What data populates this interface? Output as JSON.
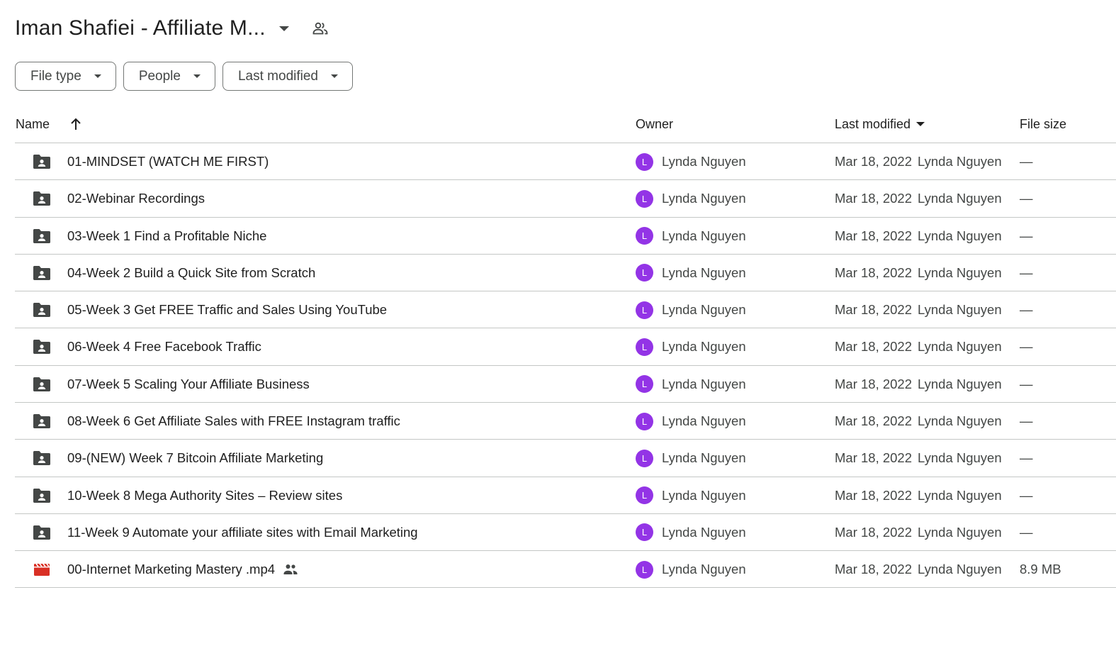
{
  "header": {
    "title": "Iman Shafiei - Affiliate M...",
    "caret_icon": "arrow-drop-down-icon",
    "shared_icon": "people-outline-icon"
  },
  "filters": [
    {
      "label": "File type"
    },
    {
      "label": "People"
    },
    {
      "label": "Last modified"
    }
  ],
  "columns": {
    "name": "Name",
    "owner": "Owner",
    "last_modified": "Last modified",
    "file_size": "File size"
  },
  "colors": {
    "avatar": "#9334e6",
    "folder_icon": "#444746",
    "video_icon": "#d93025",
    "divider": "#c4c7c5"
  },
  "rows": [
    {
      "type": "folder",
      "name": "01-MINDSET (WATCH ME FIRST)",
      "owner_initial": "L",
      "owner": "Lynda Nguyen",
      "modified_date": "Mar 18, 2022",
      "modified_by": "Lynda Nguyen",
      "size": "—",
      "shared": false
    },
    {
      "type": "folder",
      "name": "02-Webinar Recordings",
      "owner_initial": "L",
      "owner": "Lynda Nguyen",
      "modified_date": "Mar 18, 2022",
      "modified_by": "Lynda Nguyen",
      "size": "—",
      "shared": false
    },
    {
      "type": "folder",
      "name": "03-Week 1 Find a Profitable Niche",
      "owner_initial": "L",
      "owner": "Lynda Nguyen",
      "modified_date": "Mar 18, 2022",
      "modified_by": "Lynda Nguyen",
      "size": "—",
      "shared": false
    },
    {
      "type": "folder",
      "name": "04-Week 2 Build a Quick Site from Scratch",
      "owner_initial": "L",
      "owner": "Lynda Nguyen",
      "modified_date": "Mar 18, 2022",
      "modified_by": "Lynda Nguyen",
      "size": "—",
      "shared": false
    },
    {
      "type": "folder",
      "name": "05-Week 3 Get FREE Traffic and Sales Using YouTube",
      "owner_initial": "L",
      "owner": "Lynda Nguyen",
      "modified_date": "Mar 18, 2022",
      "modified_by": "Lynda Nguyen",
      "size": "—",
      "shared": false
    },
    {
      "type": "folder",
      "name": "06-Week 4 Free Facebook Traffic",
      "owner_initial": "L",
      "owner": "Lynda Nguyen",
      "modified_date": "Mar 18, 2022",
      "modified_by": "Lynda Nguyen",
      "size": "—",
      "shared": false
    },
    {
      "type": "folder",
      "name": "07-Week 5 Scaling Your Affiliate Business",
      "owner_initial": "L",
      "owner": "Lynda Nguyen",
      "modified_date": "Mar 18, 2022",
      "modified_by": "Lynda Nguyen",
      "size": "—",
      "shared": false
    },
    {
      "type": "folder",
      "name": "08-Week 6 Get Affiliate Sales with FREE Instagram traffic",
      "owner_initial": "L",
      "owner": "Lynda Nguyen",
      "modified_date": "Mar 18, 2022",
      "modified_by": "Lynda Nguyen",
      "size": "—",
      "shared": false
    },
    {
      "type": "folder",
      "name": "09-(NEW) Week 7 Bitcoin Affiliate Marketing",
      "owner_initial": "L",
      "owner": "Lynda Nguyen",
      "modified_date": "Mar 18, 2022",
      "modified_by": "Lynda Nguyen",
      "size": "—",
      "shared": false
    },
    {
      "type": "folder",
      "name": "10-Week 8 Mega Authority Sites – Review sites",
      "owner_initial": "L",
      "owner": "Lynda Nguyen",
      "modified_date": "Mar 18, 2022",
      "modified_by": "Lynda Nguyen",
      "size": "—",
      "shared": false
    },
    {
      "type": "folder",
      "name": "11-Week 9 Automate your affiliate sites with Email Marketing",
      "owner_initial": "L",
      "owner": "Lynda Nguyen",
      "modified_date": "Mar 18, 2022",
      "modified_by": "Lynda Nguyen",
      "size": "—",
      "shared": false
    },
    {
      "type": "video",
      "name": "00-Internet Marketing Mastery .mp4",
      "owner_initial": "L",
      "owner": "Lynda Nguyen",
      "modified_date": "Mar 18, 2022",
      "modified_by": "Lynda Nguyen",
      "size": "8.9 MB",
      "shared": true
    }
  ]
}
